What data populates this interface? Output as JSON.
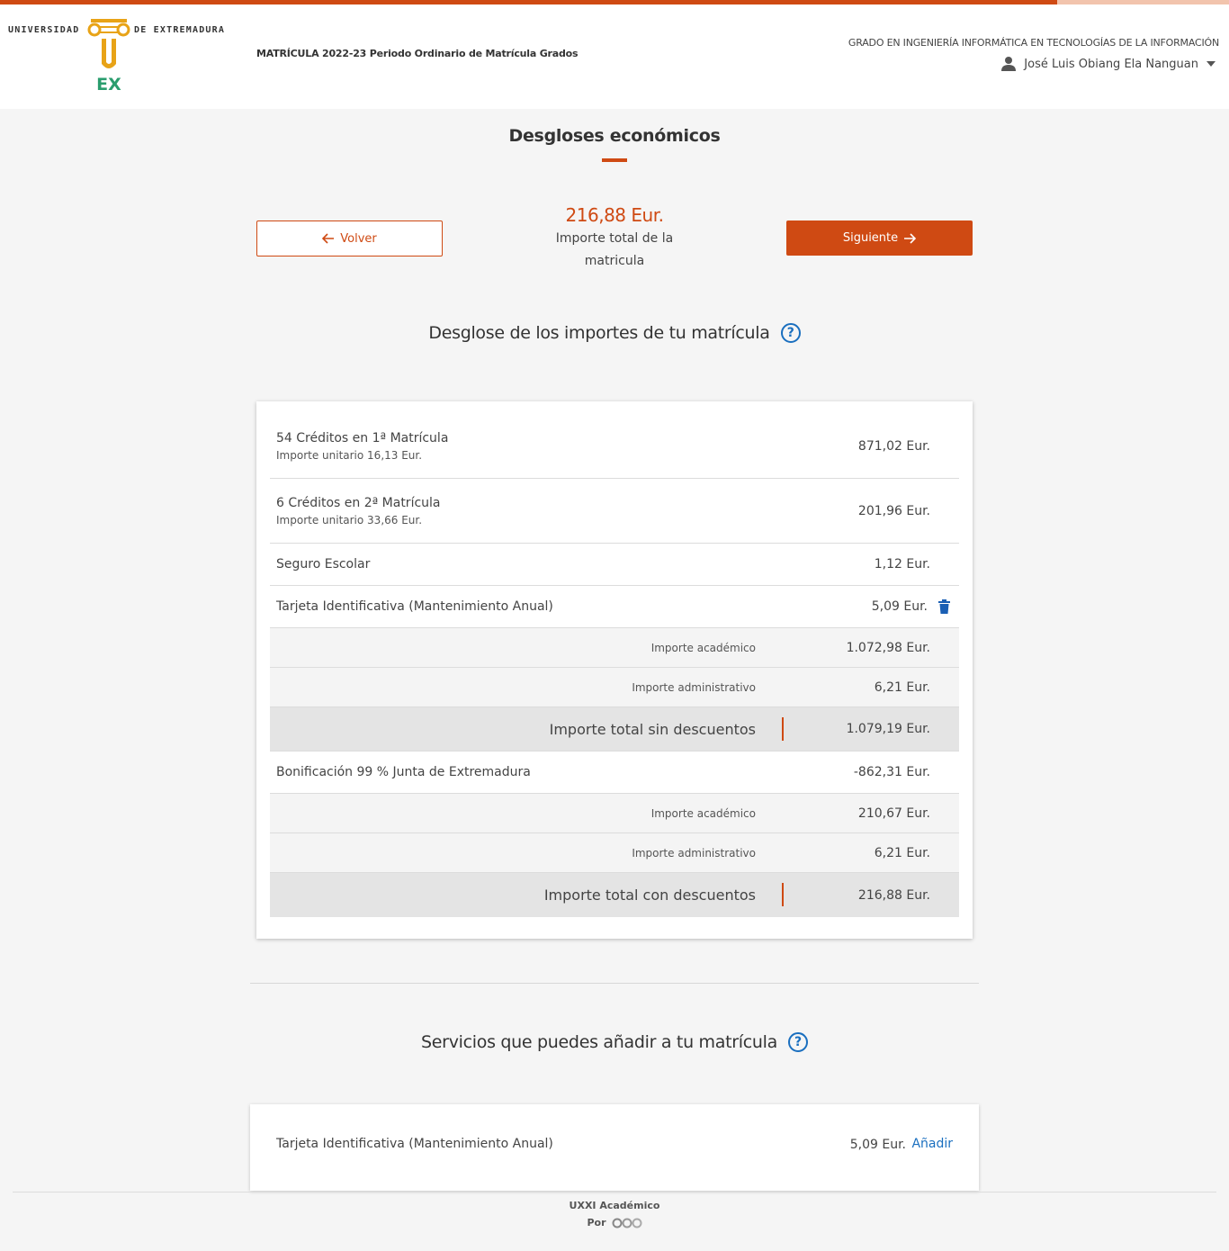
{
  "progress": {
    "fraction": 0.86
  },
  "colors": {
    "accent": "#cf4a13",
    "link": "#1a6fbf",
    "logo_yellow": "#e8a317",
    "logo_green": "#2a9d6e"
  },
  "header": {
    "logo_left": "UNIVERSIDAD",
    "logo_right": "DE EXTREMADURA",
    "logo_mark": "UEX",
    "course_title": "MATRÍCULA 2022-23 Periodo Ordinario de Matrícula Grados",
    "degree": "GRADO EN INGENIERÍA INFORMÁTICA EN TECNOLOGÍAS DE LA INFORMACIÓN",
    "user_name": "José Luis Obiang Ela Nanguan",
    "user_icon": "person-icon",
    "dropdown_icon": "caret-down-icon"
  },
  "page": {
    "title": "Desgloses económicos",
    "back_label": "Volver",
    "next_label": "Siguiente",
    "total_amount": "216,88 Eur.",
    "total_label": "Importe total de la matricula"
  },
  "breakdown": {
    "heading": "Desglose de los importes de tu matrícula",
    "help": "?",
    "items": [
      {
        "label": "54 Créditos en 1ª Matrícula",
        "sub": "Importe unitario 16,13 Eur.",
        "amount": "871,02 Eur."
      },
      {
        "label": "6 Créditos en 2ª Matrícula",
        "sub": "Importe unitario 33,66 Eur.",
        "amount": "201,96 Eur."
      },
      {
        "label": "Seguro Escolar",
        "amount": "1,12 Eur."
      },
      {
        "label": "Tarjeta Identificativa (Mantenimiento Anual)",
        "amount": "5,09 Eur.",
        "delete_icon": "trash-icon"
      }
    ],
    "summary1": {
      "academic_label": "Importe académico",
      "academic_amount": "1.072,98 Eur.",
      "admin_label": "Importe administrativo",
      "admin_amount": "6,21 Eur.",
      "total_label": "Importe total sin descuentos",
      "total_amount": "1.079,19 Eur."
    },
    "discount": {
      "label": "Bonificación 99 % Junta de Extremadura",
      "amount": "-862,31 Eur."
    },
    "summary2": {
      "academic_label": "Importe académico",
      "academic_amount": "210,67 Eur.",
      "admin_label": "Importe administrativo",
      "admin_amount": "6,21 Eur.",
      "total_label": "Importe total con descuentos",
      "total_amount": "216,88 Eur."
    }
  },
  "services": {
    "heading": "Servicios que puedes añadir a tu matrícula",
    "help": "?",
    "item": {
      "label": "Tarjeta Identificativa (Mantenimiento Anual)",
      "amount": "5,09 Eur.",
      "action": "Añadir"
    }
  },
  "footer": {
    "line1": "UXXI Académico",
    "line2": "Por",
    "logo_icon": "ocu-logo-icon"
  }
}
